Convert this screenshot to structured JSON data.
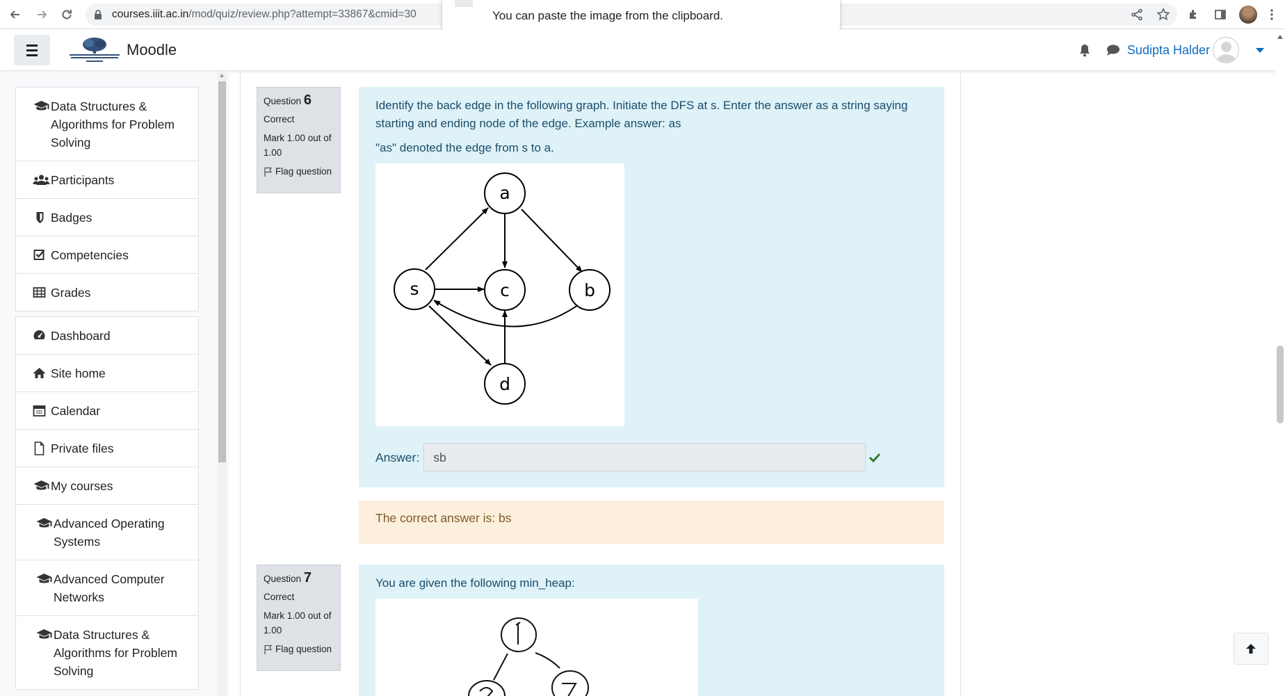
{
  "browser": {
    "url_host": "courses.iiit.ac.in",
    "url_path": "/mod/quiz/review.php?attempt=33867&cmid=30",
    "toast_text": "You can paste the image from the clipboard."
  },
  "navbar": {
    "brand": "Moodle",
    "user_name": "Sudipta Halder"
  },
  "drawer": {
    "group1": [
      {
        "label": "Data Structures & Algorithms for Problem Solving",
        "icon": "graduation-cap-icon"
      },
      {
        "label": "Participants",
        "icon": "users-icon"
      },
      {
        "label": "Badges",
        "icon": "shield-icon"
      },
      {
        "label": "Competencies",
        "icon": "check-square-icon"
      },
      {
        "label": "Grades",
        "icon": "table-icon"
      }
    ],
    "group2": [
      {
        "label": "Dashboard",
        "icon": "dashboard-icon"
      },
      {
        "label": "Site home",
        "icon": "home-icon"
      },
      {
        "label": "Calendar",
        "icon": "calendar-icon"
      },
      {
        "label": "Private files",
        "icon": "file-icon"
      },
      {
        "label": "My courses",
        "icon": "graduation-cap-icon"
      },
      {
        "label": "Advanced Operating Systems",
        "icon": "graduation-cap-icon"
      },
      {
        "label": "Advanced Computer Networks",
        "icon": "graduation-cap-icon"
      },
      {
        "label": "Data Structures & Algorithms for Problem Solving",
        "icon": "graduation-cap-icon"
      }
    ]
  },
  "q6": {
    "label": "Question",
    "number": "6",
    "state": "Correct",
    "grade": "Mark 1.00 out of 1.00",
    "flag": "Flag question",
    "text1": "Identify the back edge in the following graph. Initiate the DFS at s. Enter the answer as a string saying starting and ending node of the edge. Example answer: as",
    "text2": "\"as\" denoted the edge from s to a.",
    "graph_nodes": [
      "a",
      "s",
      "c",
      "b",
      "d"
    ],
    "answer_label": "Answer:",
    "answer_value": "sb",
    "correct_answer": "The correct answer is: bs"
  },
  "q7": {
    "label": "Question",
    "number": "7",
    "state": "Correct",
    "grade": "Mark 1.00 out of 1.00",
    "flag": "Flag question",
    "text1": "You are given the following min_heap:"
  }
}
